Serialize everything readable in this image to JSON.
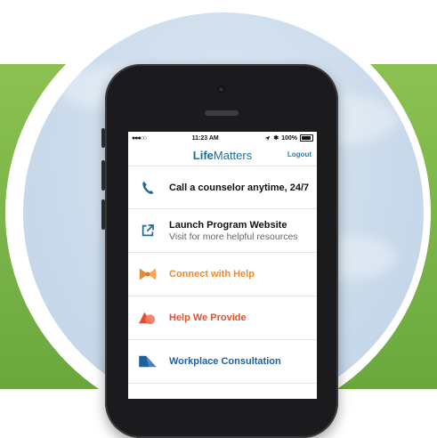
{
  "status_bar": {
    "signal": "●●●○○",
    "time": "11:23 AM",
    "bluetooth": "✱",
    "battery": "100%"
  },
  "nav": {
    "logo_bold": "Life",
    "logo_thin": "Matters",
    "logout": "Logout"
  },
  "menu": {
    "items": [
      {
        "label": "Call a counselor anytime, 24/7",
        "icon": "phone-icon",
        "color": "#111111"
      },
      {
        "label": "Launch Program Website",
        "subtitle": "Visit for more helpful resources",
        "icon": "external-link-icon",
        "color": "#111111"
      },
      {
        "label": "Connect with Help",
        "icon": "bowtie-icon",
        "color": "#f0892b"
      },
      {
        "label": "Help We Provide",
        "icon": "shapes-icon",
        "color": "#e0502f"
      },
      {
        "label": "Workplace Consultation",
        "icon": "triangle-icon",
        "color": "#1f5f9e"
      }
    ]
  },
  "colors": {
    "background_green": "#7ab648",
    "sky_blue": "#cfdeed",
    "link_blue": "#2b7fb8",
    "logo_blue": "#1f6c9c"
  }
}
